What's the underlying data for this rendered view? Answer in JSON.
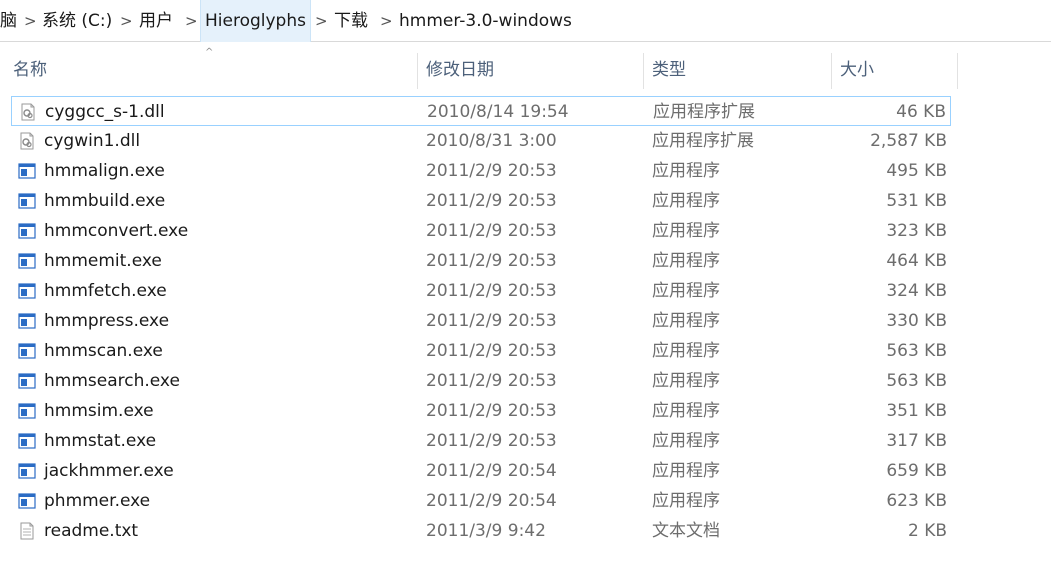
{
  "breadcrumb": {
    "items": [
      "脑",
      "系统 (C:)",
      "用户",
      "Hieroglyphs",
      "下载",
      "hmmer-3.0-windows"
    ],
    "separator": ">"
  },
  "columns": {
    "name": "名称",
    "date": "修改日期",
    "type": "类型",
    "size": "大小"
  },
  "sort_indicator": "^",
  "files": [
    {
      "name": "cyggcc_s-1.dll",
      "date": "2010/8/14 19:54",
      "type": "应用程序扩展",
      "size": "46 KB",
      "icon": "dll-file-icon"
    },
    {
      "name": "cygwin1.dll",
      "date": "2010/8/31 3:00",
      "type": "应用程序扩展",
      "size": "2,587 KB",
      "icon": "dll-file-icon"
    },
    {
      "name": "hmmalign.exe",
      "date": "2011/2/9 20:53",
      "type": "应用程序",
      "size": "495 KB",
      "icon": "exe-file-icon"
    },
    {
      "name": "hmmbuild.exe",
      "date": "2011/2/9 20:53",
      "type": "应用程序",
      "size": "531 KB",
      "icon": "exe-file-icon"
    },
    {
      "name": "hmmconvert.exe",
      "date": "2011/2/9 20:53",
      "type": "应用程序",
      "size": "323 KB",
      "icon": "exe-file-icon"
    },
    {
      "name": "hmmemit.exe",
      "date": "2011/2/9 20:53",
      "type": "应用程序",
      "size": "464 KB",
      "icon": "exe-file-icon"
    },
    {
      "name": "hmmfetch.exe",
      "date": "2011/2/9 20:53",
      "type": "应用程序",
      "size": "324 KB",
      "icon": "exe-file-icon"
    },
    {
      "name": "hmmpress.exe",
      "date": "2011/2/9 20:53",
      "type": "应用程序",
      "size": "330 KB",
      "icon": "exe-file-icon"
    },
    {
      "name": "hmmscan.exe",
      "date": "2011/2/9 20:53",
      "type": "应用程序",
      "size": "563 KB",
      "icon": "exe-file-icon"
    },
    {
      "name": "hmmsearch.exe",
      "date": "2011/2/9 20:53",
      "type": "应用程序",
      "size": "563 KB",
      "icon": "exe-file-icon"
    },
    {
      "name": "hmmsim.exe",
      "date": "2011/2/9 20:53",
      "type": "应用程序",
      "size": "351 KB",
      "icon": "exe-file-icon"
    },
    {
      "name": "hmmstat.exe",
      "date": "2011/2/9 20:53",
      "type": "应用程序",
      "size": "317 KB",
      "icon": "exe-file-icon"
    },
    {
      "name": "jackhmmer.exe",
      "date": "2011/2/9 20:54",
      "type": "应用程序",
      "size": "659 KB",
      "icon": "exe-file-icon"
    },
    {
      "name": "phmmer.exe",
      "date": "2011/2/9 20:54",
      "type": "应用程序",
      "size": "623 KB",
      "icon": "exe-file-icon"
    },
    {
      "name": "readme.txt",
      "date": "2011/3/9 9:42",
      "type": "文本文档",
      "size": "2 KB",
      "icon": "text-file-icon"
    }
  ],
  "colors": {
    "selection_border": "#99d1ff",
    "active_crumb": "#e5f1fb",
    "header_text": "#4c607a",
    "secondary_text": "#6d6d6d",
    "exe_icon_blue": "#2b6cc4"
  }
}
